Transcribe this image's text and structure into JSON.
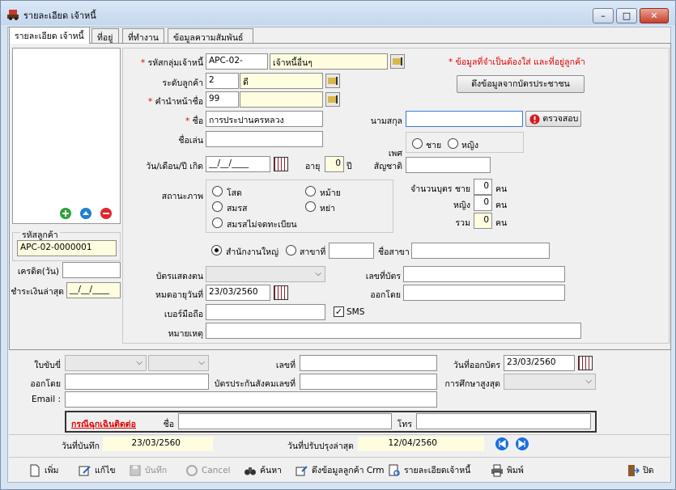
{
  "window": {
    "title": "รายละเอียด เจ้าหนี้"
  },
  "tabs": [
    "รายละเอียด เจ้าหนี้",
    "ที่อยู่",
    "ที่ทำงาน",
    "ข้อมูลความสัมพันธ์"
  ],
  "left": {
    "customer_code_label": "รหัสลูกค้า",
    "customer_code": "APC-02-0000001",
    "credit_label": "เครดิต(วัน)",
    "credit_value": "",
    "last_payment_label": "ชำระเงินล่าสุด",
    "last_payment_value": "__/__/____"
  },
  "form": {
    "group_label": "รหัสกลุ่มเจ้าหนี้",
    "group_code": "APC-02-",
    "group_name": "เจ้าหนี้อื่นๆ",
    "level_label": "ระดับลูกค้า",
    "level_code": "2",
    "level_name": "ดี",
    "prefix_label": "คำนำหน้าชื่อ",
    "prefix_code": "99",
    "prefix_name": "",
    "name_label": "ชื่อ",
    "name_value": "การประปานครหลวง",
    "surname_label": "นามสกุล",
    "surname_value": "",
    "check_button": "ตรวจสอบ",
    "nickname_label": "ชื่อเล่น",
    "nickname_value": "",
    "gender_label": "เพศ",
    "gender_male": "ชาย",
    "gender_female": "หญิง",
    "dob_label": "วัน/เดือน/ปี เกิด",
    "dob_value": "__/__/____",
    "age_label": "อายุ",
    "age_value": "0",
    "age_unit": "ปี",
    "nationality_label": "สัญชาติ",
    "nationality_value": "",
    "required_note": "* ข้อมูลที่จำเป็นต้องใส่ และที่อยู่ลูกค้า",
    "id_card_button": "ดึงข้อมูลจากบัตรประชาชน",
    "status_label": "สถานะภาพ",
    "status_single": "โสด",
    "status_married": "สมรส",
    "status_unregistered": "สมรสไม่จดทะเบียน",
    "status_widowed": "หม้าย",
    "status_divorced": "หย่า",
    "children_label": "จำนวนบุตร ชาย",
    "children_male": "0",
    "children_female_label": "หญิง",
    "children_female": "0",
    "children_total_label": "รวม",
    "children_total": "0",
    "children_unit": "คน",
    "hq_label": "สำนักงานใหญ่",
    "branch_label": "สาขาที่",
    "branch_value": "",
    "branch_name_label": "ชื่อสาขา",
    "branch_name_value": "",
    "card_label": "บัตรแสดงตน",
    "card_no_label": "เลขที่บัตร",
    "card_no_value": "",
    "expire_label": "หมดอายุวันที่",
    "expire_value": "23/03/2560",
    "issued_by_label": "ออกโดย",
    "issued_by_value": "",
    "mobile_label": "เบอร์มือถือ",
    "mobile_value": "",
    "sms_label": "SMS",
    "note_label": "หมายเหตุ",
    "note_value": ""
  },
  "lower": {
    "license_label": "ใบขับขี่",
    "number_label": "เลขที่",
    "number_value": "",
    "issue_date_label": "วันที่ออกบัตร",
    "issue_date_value": "23/03/2560",
    "issued_by_label": "ออกโดย",
    "issued_by_value": "",
    "ssn_label": "บัตรประกันสังคมเลขที่",
    "ssn_value": "",
    "education_label": "การศึกษาสูงสุด",
    "email_label": "Email :",
    "email_value": "",
    "emergency_label": "กรณีฉุกเฉินติดต่อ",
    "emergency_name_label": "ชื่อ",
    "emergency_name_value": "",
    "emergency_phone_label": "โทร",
    "emergency_phone_value": ""
  },
  "status_bar": {
    "saved_label": "วันที่บันทึก",
    "saved_value": "23/03/2560",
    "updated_label": "วันที่ปรับปรุงล่าสุด",
    "updated_value": "12/04/2560"
  },
  "toolbar": {
    "add": "เพิ่ม",
    "edit": "แก้ไข",
    "save": "บันทึก",
    "cancel": "Cancel",
    "search": "ค้นหา",
    "crm": "ดึงข้อมูลลูกค้า Crm",
    "creditor_detail": "รายละเอียดเจ้าหนี้",
    "print": "พิมพ์",
    "close": "ปิด"
  }
}
